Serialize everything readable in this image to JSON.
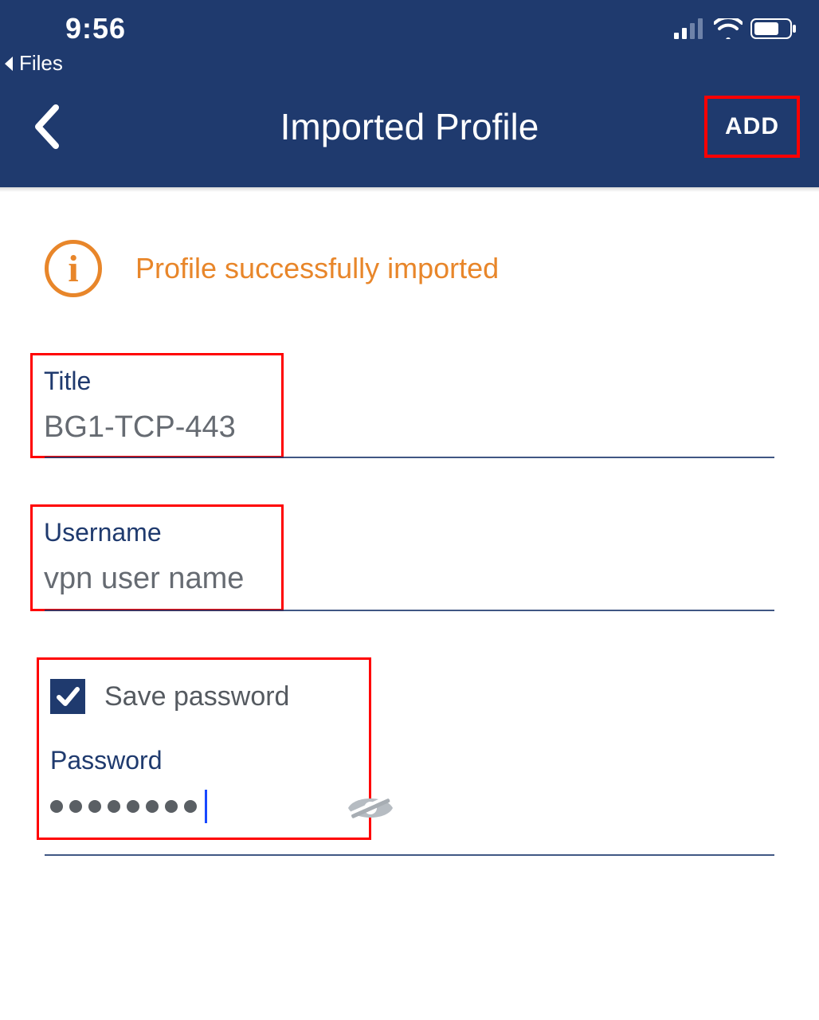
{
  "statusbar": {
    "time": "9:56",
    "back_app": "Files"
  },
  "header": {
    "title": "Imported Profile",
    "add_button": "ADD"
  },
  "notice": {
    "text": "Profile successfully imported"
  },
  "fields": {
    "title_label": "Title",
    "title_value": "BG1-TCP-443",
    "username_label": "Username",
    "username_value": "vpn user name",
    "save_password_label": "Save password",
    "save_password_checked": true,
    "password_label": "Password",
    "password_masked_length": 8
  },
  "colors": {
    "header_bg": "#1f3a6e",
    "accent_orange": "#e8862a",
    "highlight_red": "#ff0000"
  }
}
